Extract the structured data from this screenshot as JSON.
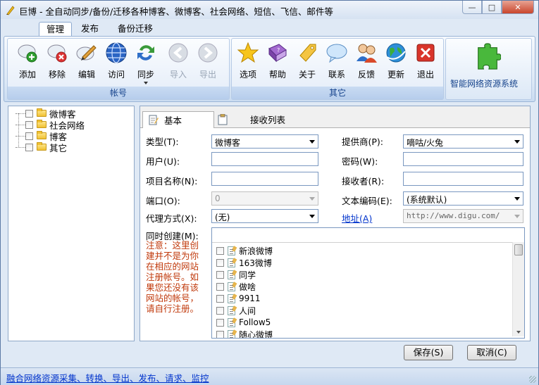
{
  "window": {
    "title": "巨博 - 全自动同步/备份/迁移各种博客、微博客、社会网络、短信、飞信、邮件等"
  },
  "ribbon_tabs": [
    "管理",
    "发布",
    "备份迁移"
  ],
  "account_group": {
    "label": "帐号",
    "buttons": [
      {
        "label": "添加",
        "icon": "add-user-icon"
      },
      {
        "label": "移除",
        "icon": "remove-user-icon"
      },
      {
        "label": "编辑",
        "icon": "edit-icon"
      },
      {
        "label": "访问",
        "icon": "globe-icon"
      },
      {
        "label": "同步",
        "icon": "sync-icon"
      },
      {
        "label": "导入",
        "icon": "import-icon"
      },
      {
        "label": "导出",
        "icon": "export-icon"
      }
    ]
  },
  "other_group": {
    "label": "其它",
    "buttons": [
      {
        "label": "选项",
        "icon": "star-icon"
      },
      {
        "label": "帮助",
        "icon": "help-book-icon"
      },
      {
        "label": "关于",
        "icon": "tag-icon"
      },
      {
        "label": "联系",
        "icon": "chat-bubble-icon"
      },
      {
        "label": "反馈",
        "icon": "users-icon"
      },
      {
        "label": "更新",
        "icon": "update-globe-icon"
      },
      {
        "label": "退出",
        "icon": "exit-icon"
      }
    ]
  },
  "brand": {
    "label": "智能网络资源系统",
    "icon": "puzzle-icon"
  },
  "tree": {
    "items": [
      "微博客",
      "社会网络",
      "博客",
      "其它"
    ]
  },
  "panel": {
    "tabs": [
      "基本",
      "接收列表"
    ],
    "fields": {
      "type_label": "类型(T):",
      "type_value": "微博客",
      "provider_label": "提供商(P):",
      "provider_value": "嘀咕/火兔",
      "user_label": "用户(U):",
      "user_value": "",
      "password_label": "密码(W):",
      "password_value": "",
      "project_label": "项目名称(N):",
      "project_value": "",
      "receiver_label": "接收者(R):",
      "receiver_value": "",
      "port_label": "端口(O):",
      "port_value": "0",
      "encoding_label": "文本编码(E):",
      "encoding_value": "(系统默认)",
      "proxy_label": "代理方式(X):",
      "proxy_value": "(无)",
      "address_label": "地址(A)",
      "address_value": "http://www.digu.com/",
      "sync_label": "同时创建(M):"
    },
    "note": "注意：这里创建并不是为你在相应的网站注册帐号。如果您还没有该网站的帐号，请自行注册。",
    "sync_list": [
      "新浪微博",
      "163微博",
      "同学",
      "做啥",
      "9911",
      "人间",
      "Follow5",
      "随心微博"
    ]
  },
  "buttons": {
    "save": "保存(S)",
    "cancel": "取消(C)"
  },
  "status": {
    "text": "融合网络资源采集、转换、导出、发布、请求、监控"
  }
}
